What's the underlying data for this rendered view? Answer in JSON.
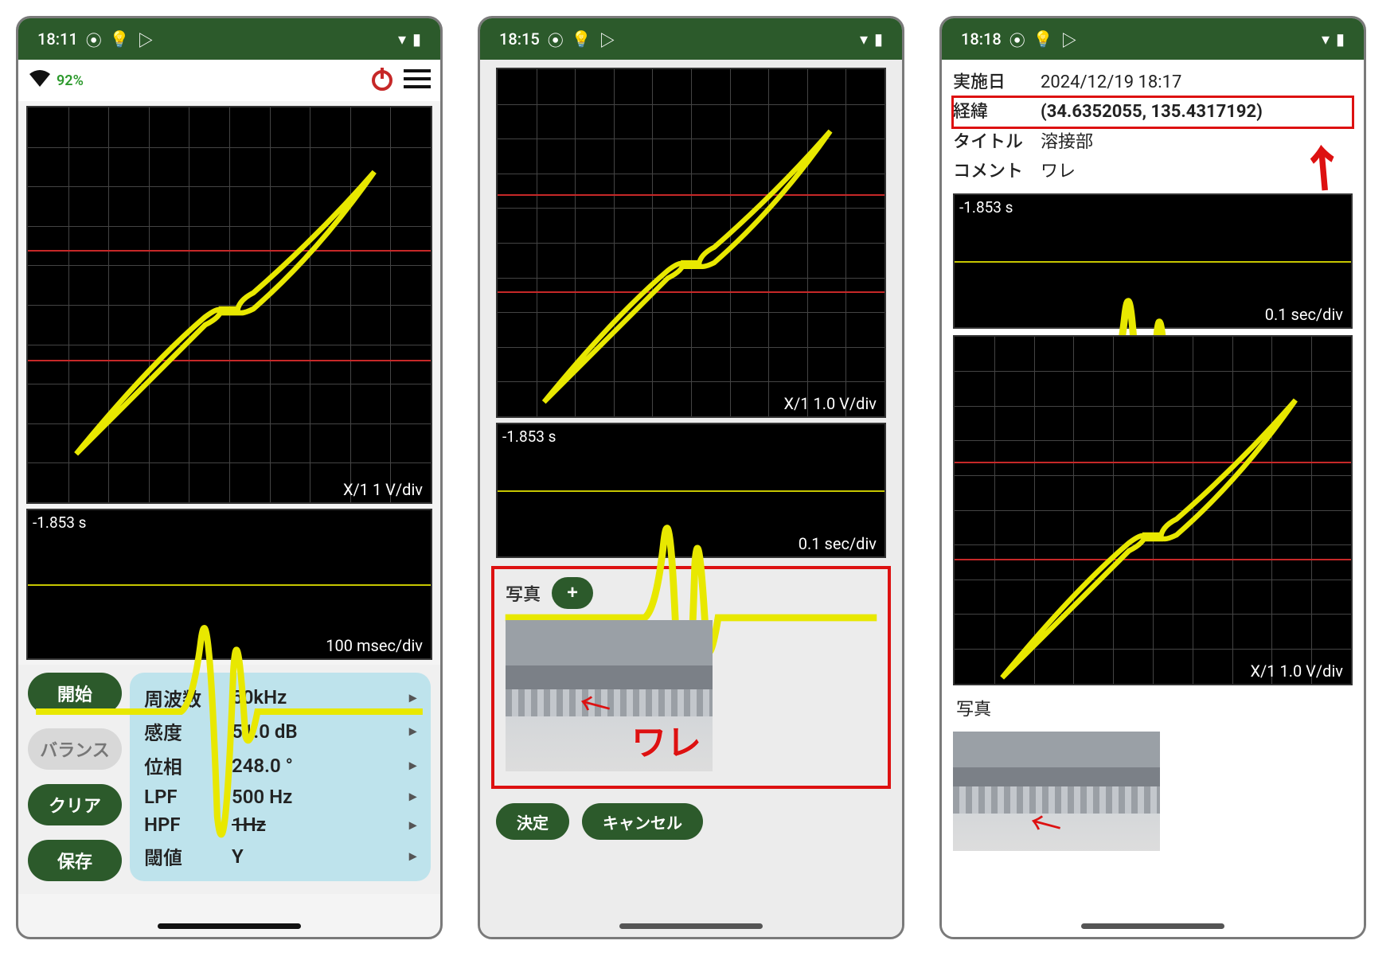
{
  "panel1": {
    "status": {
      "time": "18:11"
    },
    "battery": "92%",
    "chart_xy_label": "X/1  1 V/div",
    "chart_ts_tl": "-1.853 s",
    "chart_ts_br": "100 msec/div",
    "buttons": {
      "start": "開始",
      "balance": "バランス",
      "clear": "クリア",
      "save": "保存"
    },
    "params": [
      {
        "label": "周波数",
        "value": "50kHz"
      },
      {
        "label": "感度",
        "value": "51.0 dB"
      },
      {
        "label": "位相",
        "value": "248.0 °"
      },
      {
        "label": "LPF",
        "value": "500 Hz"
      },
      {
        "label": "HPF",
        "value": "1Hz",
        "strike": true
      },
      {
        "label": "閾値",
        "value": "Y"
      }
    ]
  },
  "panel2": {
    "status": {
      "time": "18:15"
    },
    "chart_xy_label": "X/1  1.0 V/div",
    "chart_ts_tl": "-1.853 s",
    "chart_ts_br": "0.1 sec/div",
    "photo_label": "写真",
    "photo_annotation": "ワレ",
    "actions": {
      "ok": "決定",
      "cancel": "キャンセル"
    }
  },
  "panel3": {
    "status": {
      "time": "18:18"
    },
    "meta": {
      "date_k": "実施日",
      "date_v": "2024/12/19 18:17",
      "coord_k": "経緯",
      "coord_v": "(34.6352055, 135.4317192)",
      "title_k": "タイトル",
      "title_v": "溶接部",
      "comment_k": "コメント",
      "comment_v": "ワレ"
    },
    "chart_ts_tl": "-1.853 s",
    "chart_ts_br": "0.1 sec/div",
    "chart_xy_label": "X/1  1.0 V/div",
    "photo_label": "写真"
  },
  "chart_data": [
    {
      "type": "line",
      "name": "lissajous-xy",
      "xlabel": "X/1",
      "ylabel": "",
      "note": "Elongated diagonal lissajous figure (~45°) with small central S-loop; two horizontal red threshold lines approx ±1V",
      "xlim": [
        -5,
        5
      ],
      "ylim": [
        -5,
        5
      ],
      "x_scale": "1 V/div",
      "y_scale": "1 V/div",
      "threshold_lines_y": [
        -1,
        1
      ]
    },
    {
      "type": "line",
      "name": "timeseries",
      "xlabel": "t",
      "ylabel": "",
      "x": [
        -1.853,
        -1.0,
        -0.4,
        -0.25,
        -0.1,
        0.0,
        0.1,
        0.25,
        0.4,
        1.0
      ],
      "values": [
        0,
        0,
        0.2,
        1.4,
        -1.8,
        -0.3,
        1.0,
        -0.3,
        0,
        0
      ],
      "x_scale": "100 msec/div",
      "title": "-1.853 s"
    }
  ]
}
